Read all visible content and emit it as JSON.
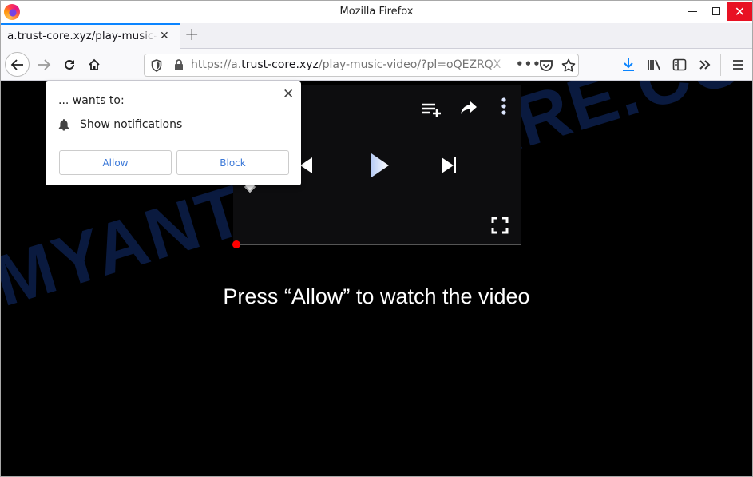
{
  "window": {
    "title": "Mozilla Firefox",
    "controls": {
      "minimize": "minimize",
      "maximize": "maximize",
      "close": "✕"
    }
  },
  "tabs": [
    {
      "title": "a.trust-core.xyz/play-music-video/",
      "close": "✕",
      "active": true
    }
  ],
  "new_tab": "+",
  "navbar": {
    "url_prefix": "https://a.",
    "url_domain": "trust-core.xyz",
    "url_path": "/play-music-video/?pl=oQEZRQX",
    "page_actions": "•••"
  },
  "colors": {
    "accent": "#0a84ff",
    "close_red": "#e81123",
    "download_blue": "#0a84ff",
    "progress_red": "#ff0000",
    "button_blue": "#3b78d8",
    "watermark": "#0c1f4a"
  },
  "permission_popup": {
    "title": "... wants to:",
    "permission": "Show notifications",
    "allow_label": "Allow",
    "block_label": "Block",
    "close": "✕"
  },
  "player": {
    "progress_fraction": 0.0
  },
  "page": {
    "cta_text": "Press “Allow” to watch the video",
    "watermark": "MYANTISPYWARE.COM"
  }
}
